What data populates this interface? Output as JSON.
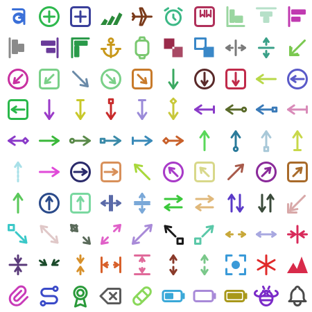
{
  "icons": [
    {
      "name": "letter-a-square-icon",
      "color": "#3a6fd8"
    },
    {
      "name": "plus-circle-icon",
      "color": "#2db84d"
    },
    {
      "name": "plus-square-icon",
      "color": "#3a3f9a"
    },
    {
      "name": "adidas-logo-icon",
      "color": "#2a8a3a"
    },
    {
      "name": "airplane-icon",
      "color": "#7a3a1a"
    },
    {
      "name": "alarm-clock-icon",
      "color": "#3cb886"
    },
    {
      "name": "album-icon",
      "color": "#b0305a"
    },
    {
      "name": "align-bottom-left-icon",
      "color": "#9ad6a0"
    },
    {
      "name": "align-center-top-icon",
      "color": "#b6e0c8"
    },
    {
      "name": "align-left-icon",
      "color": "#c03ab0"
    },
    {
      "name": "align-left-bars-icon",
      "color": "#8a8a8a"
    },
    {
      "name": "align-right-bars-icon",
      "color": "#6a3a9a"
    },
    {
      "name": "align-top-left-icon",
      "color": "#2a9a4a"
    },
    {
      "name": "anchor-icon",
      "color": "#c8981a"
    },
    {
      "name": "apple-watch-icon",
      "color": "#7ac870"
    },
    {
      "name": "arrange-squares-icon",
      "color": "#9a2a4a"
    },
    {
      "name": "arrange-squares-alt-icon",
      "color": "#3a88c8"
    },
    {
      "name": "arrow-autofit-width-icon",
      "color": "#7a7a7a"
    },
    {
      "name": "arrow-autofit-height-icon",
      "color": "#3aa088"
    },
    {
      "name": "arrow-down-left-icon",
      "color": "#7ac850"
    },
    {
      "name": "arrow-down-left-circle-icon",
      "color": "#c830a0"
    },
    {
      "name": "arrow-down-left-square-icon",
      "color": "#7ad088"
    },
    {
      "name": "arrow-down-right-icon",
      "color": "#6a8aa8"
    },
    {
      "name": "arrow-down-right-circle-icon",
      "color": "#7ad088"
    },
    {
      "name": "arrow-down-right-square-icon",
      "color": "#c87a2a"
    },
    {
      "name": "arrow-down-icon",
      "color": "#3aa860"
    },
    {
      "name": "arrow-down-circle-icon",
      "color": "#5a2a2a"
    },
    {
      "name": "arrow-down-square-icon",
      "color": "#c02a4a"
    },
    {
      "name": "arrow-left-icon",
      "color": "#b8d848"
    },
    {
      "name": "arrow-left-circle-icon",
      "color": "#5a5ac8"
    },
    {
      "name": "arrow-left-square-icon",
      "color": "#2ab84a"
    },
    {
      "name": "arrow-down-long-icon",
      "color": "#9a3ac8"
    },
    {
      "name": "arrow-down-bar-icon",
      "color": "#c8c82a"
    },
    {
      "name": "arrow-down-rhombus-icon",
      "color": "#c82a2a"
    },
    {
      "name": "arrow-down-line-icon",
      "color": "#9a8ad8"
    },
    {
      "name": "arrow-down-diamond-icon",
      "color": "#c8c83a"
    },
    {
      "name": "arrow-left-bar-icon",
      "color": "#8a3ac8"
    },
    {
      "name": "arrow-left-circle-line-icon",
      "color": "#5a6a2a"
    },
    {
      "name": "arrow-left-square-line-icon",
      "color": "#3a7ab8"
    },
    {
      "name": "arrow-left-pipe-icon",
      "color": "#d88ab8"
    },
    {
      "name": "arrow-left-right-diamond-icon",
      "color": "#8a3ac8"
    },
    {
      "name": "arrow-right-icon",
      "color": "#3ab83a"
    },
    {
      "name": "arrow-right-circle-line-icon",
      "color": "#5a8a4a"
    },
    {
      "name": "arrow-right-square-line-icon",
      "color": "#3a8aa8"
    },
    {
      "name": "arrow-right-bar-icon",
      "color": "#3a8ab8"
    },
    {
      "name": "arrow-right-diamond-icon",
      "color": "#c8602a"
    },
    {
      "name": "arrow-up-icon",
      "color": "#5ad85a"
    },
    {
      "name": "arrow-up-circle-line-icon",
      "color": "#2a7a9a"
    },
    {
      "name": "arrow-up-square-line-icon",
      "color": "#a8c8d8"
    },
    {
      "name": "arrow-up-line-icon",
      "color": "#c8d84a"
    },
    {
      "name": "arrow-up-down-dotted-icon",
      "color": "#a8e0e8"
    },
    {
      "name": "arrow-right-line-icon",
      "color": "#e04ad8"
    },
    {
      "name": "arrow-right-circle-icon",
      "color": "#2a2a6a"
    },
    {
      "name": "arrow-right-square-icon",
      "color": "#d8905a"
    },
    {
      "name": "arrow-up-left-icon",
      "color": "#a8d83a"
    },
    {
      "name": "arrow-up-left-circle-icon",
      "color": "#a83ac8"
    },
    {
      "name": "arrow-up-left-square-icon",
      "color": "#d8d88a"
    },
    {
      "name": "arrow-up-right-icon",
      "color": "#a85a4a"
    },
    {
      "name": "arrow-up-right-circle-icon",
      "color": "#8a2a9a"
    },
    {
      "name": "arrow-up-right-square-icon",
      "color": "#a86a2a"
    },
    {
      "name": "arrow-up-thin-icon",
      "color": "#5ac85a"
    },
    {
      "name": "arrow-up-circle-icon",
      "color": "#2a4a8a"
    },
    {
      "name": "arrow-up-square-icon",
      "color": "#7ad8a0"
    },
    {
      "name": "arrows-double-left-right-icon",
      "color": "#5a6aa8"
    },
    {
      "name": "arrows-down-up-icon",
      "color": "#7aa8d8"
    },
    {
      "name": "arrows-exchange-icon",
      "color": "#3ac83a"
    },
    {
      "name": "arrows-exchange-alt-icon",
      "color": "#e0b87a"
    },
    {
      "name": "arrows-up-down-icon",
      "color": "#5a3ac8"
    },
    {
      "name": "arrows-down-up-alt-icon",
      "color": "#3a4a3a"
    },
    {
      "name": "arrow-down-left-corner-icon",
      "color": "#d8a8a8"
    },
    {
      "name": "arrow-down-right-box-icon",
      "color": "#3ac8c8"
    },
    {
      "name": "arrows-diagonal-icon",
      "color": "#e0c8c8"
    },
    {
      "name": "arrows-diagonal-alt-icon",
      "color": "#5a6a5a"
    },
    {
      "name": "arrows-maximize-diagonal-icon",
      "color": "#e060c8"
    },
    {
      "name": "arrows-diagonal-2-icon",
      "color": "#a88ad8"
    },
    {
      "name": "arrow-up-left-box-icon",
      "color": "#1a1a1a"
    },
    {
      "name": "arrow-up-right-box-icon",
      "color": "#5ac8a8"
    },
    {
      "name": "arrows-horizontal-icon",
      "color": "#c8a83a"
    },
    {
      "name": "arrows-left-right-icon",
      "color": "#a8a8e0"
    },
    {
      "name": "arrows-join-icon",
      "color": "#d82a5a"
    },
    {
      "name": "arrows-join-vertical-icon",
      "color": "#5a3a7a"
    },
    {
      "name": "arrows-minimize-icon",
      "color": "#1a4a2a"
    },
    {
      "name": "arrows-shrink-icon",
      "color": "#d8902a"
    },
    {
      "name": "arrows-split-icon",
      "color": "#d8602a"
    },
    {
      "name": "arrows-vertical-split-icon",
      "color": "#e06a9a"
    },
    {
      "name": "arrows-up-down-icon",
      "color": "#8a3a2a"
    },
    {
      "name": "arrows-vertical-icon",
      "color": "#7ac88a"
    },
    {
      "name": "focus-centered-icon",
      "color": "#3a9ad8"
    },
    {
      "name": "asterisk-icon",
      "color": "#e02a2a"
    },
    {
      "name": "autodesk-logo-icon",
      "color": "#d82a4a"
    },
    {
      "name": "paperclip-icon",
      "color": "#c83ab8"
    },
    {
      "name": "route-icon",
      "color": "#3a4ac8"
    },
    {
      "name": "award-icon",
      "color": "#2a9a3a"
    },
    {
      "name": "backspace-icon",
      "color": "#5a5a5a"
    },
    {
      "name": "bandage-icon",
      "color": "#8ad85a"
    },
    {
      "name": "battery-charging-icon",
      "color": "#3aa8d8"
    },
    {
      "name": "battery-empty-icon",
      "color": "#a88ad8"
    },
    {
      "name": "battery-full-icon",
      "color": "#a8981a"
    },
    {
      "name": "bee-icon",
      "color": "#7a2ac8"
    },
    {
      "name": "bell-icon",
      "color": "#4a4a4a"
    }
  ]
}
